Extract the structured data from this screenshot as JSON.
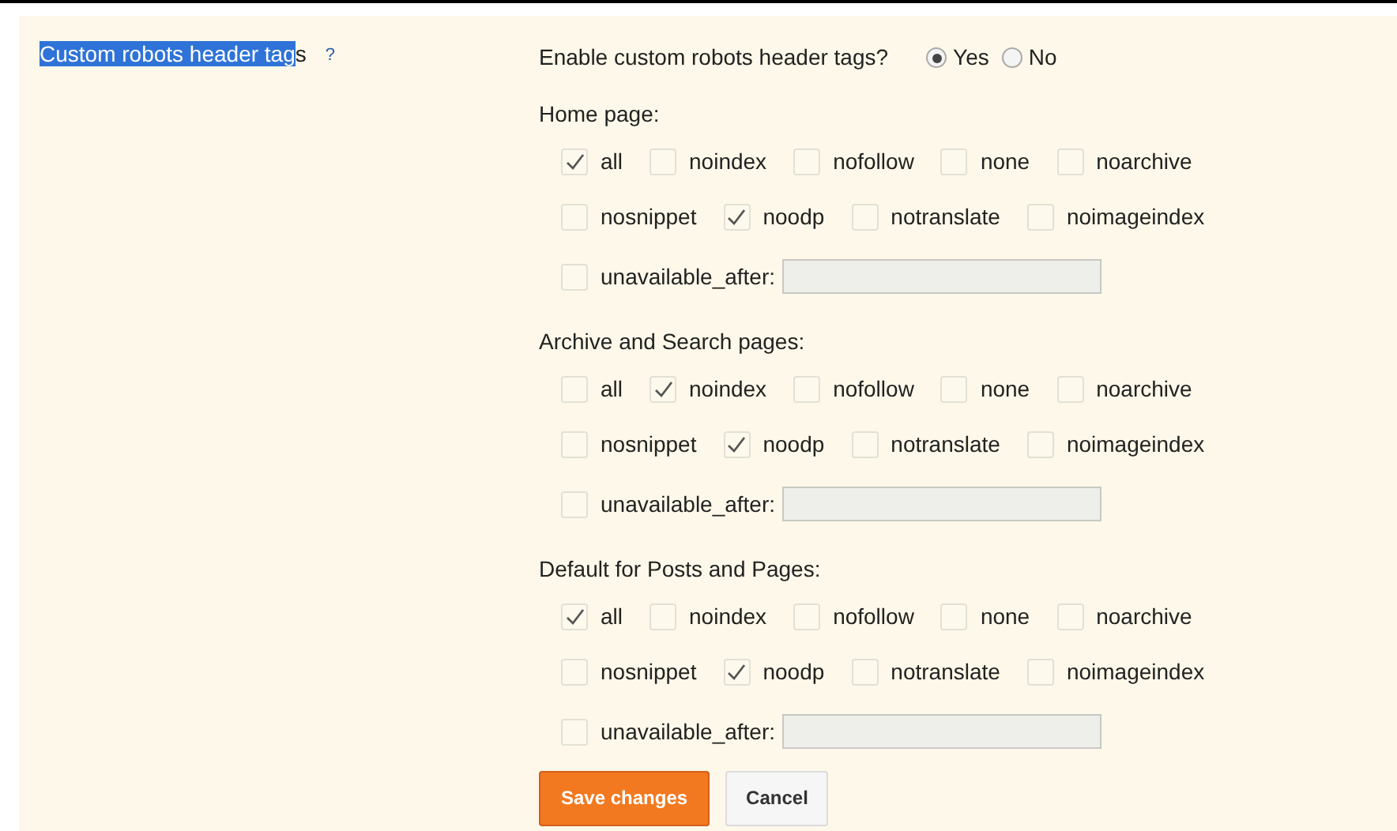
{
  "setting": {
    "selected_text": "Custom robots header tag",
    "text": "s",
    "help": "?"
  },
  "enable": {
    "label": "Enable custom robots header tags?",
    "options": [
      {
        "label": "Yes",
        "selected": true
      },
      {
        "label": "No",
        "selected": false
      }
    ]
  },
  "sections": [
    {
      "title": "Home page:",
      "options": [
        {
          "label": "all",
          "checked": true
        },
        {
          "label": "noindex",
          "checked": false
        },
        {
          "label": "nofollow",
          "checked": false
        },
        {
          "label": "none",
          "checked": false
        },
        {
          "label": "noarchive",
          "checked": false
        },
        {
          "label": "nosnippet",
          "checked": false
        },
        {
          "label": "noodp",
          "checked": true
        },
        {
          "label": "notranslate",
          "checked": false
        },
        {
          "label": "noimageindex",
          "checked": false
        }
      ],
      "unavailable": {
        "label": "unavailable_after:",
        "checked": false
      }
    },
    {
      "title": "Archive and Search pages:",
      "options": [
        {
          "label": "all",
          "checked": false
        },
        {
          "label": "noindex",
          "checked": true
        },
        {
          "label": "nofollow",
          "checked": false
        },
        {
          "label": "none",
          "checked": false
        },
        {
          "label": "noarchive",
          "checked": false
        },
        {
          "label": "nosnippet",
          "checked": false
        },
        {
          "label": "noodp",
          "checked": true
        },
        {
          "label": "notranslate",
          "checked": false
        },
        {
          "label": "noimageindex",
          "checked": false
        }
      ],
      "unavailable": {
        "label": "unavailable_after:",
        "checked": false
      }
    },
    {
      "title": "Default for Posts and Pages:",
      "options": [
        {
          "label": "all",
          "checked": true
        },
        {
          "label": "noindex",
          "checked": false
        },
        {
          "label": "nofollow",
          "checked": false
        },
        {
          "label": "none",
          "checked": false
        },
        {
          "label": "noarchive",
          "checked": false
        },
        {
          "label": "nosnippet",
          "checked": false
        },
        {
          "label": "noodp",
          "checked": true
        },
        {
          "label": "notranslate",
          "checked": false
        },
        {
          "label": "noimageindex",
          "checked": false
        }
      ],
      "unavailable": {
        "label": "unavailable_after:",
        "checked": false
      }
    }
  ],
  "buttons": [
    {
      "label": "Save changes",
      "kind": "primary"
    },
    {
      "label": "Cancel",
      "kind": "secondary"
    }
  ]
}
